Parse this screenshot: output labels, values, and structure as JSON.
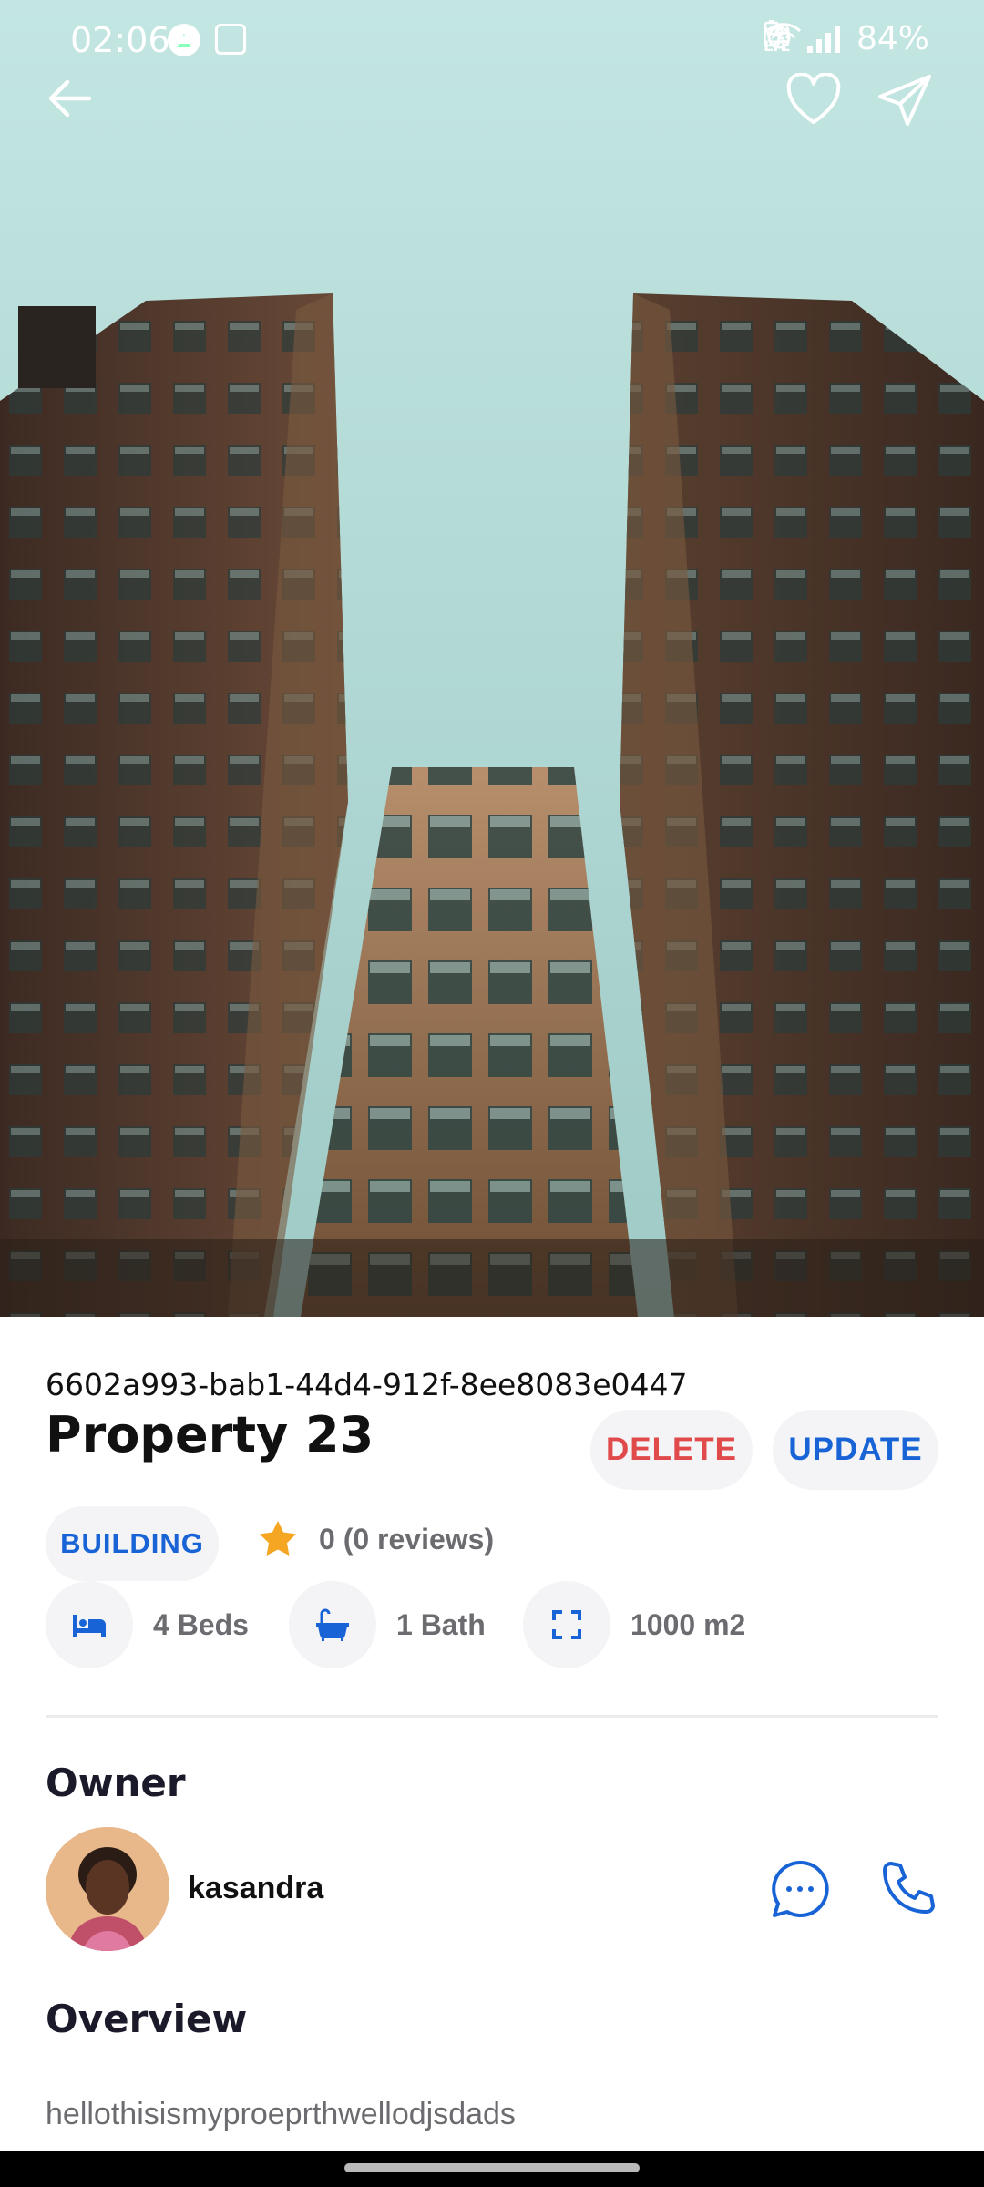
{
  "status_bar": {
    "time": "02:06",
    "battery": "84%",
    "left_icons": [
      "app-a-icon",
      "gallery-icon",
      "weather-icon"
    ],
    "right_icons": [
      "alarm-icon",
      "wifi-icon",
      "volte-icon",
      "signal-icon",
      "battery-icon"
    ]
  },
  "header": {
    "icons": [
      "back-arrow-icon",
      "heart-icon",
      "send-icon"
    ]
  },
  "property": {
    "id": "6602a993-bab1-44d4-912f-8ee8083e0447",
    "title": "Property 23",
    "delete_label": "DELETE",
    "update_label": "UPDATE",
    "type": "BUILDING",
    "rating_text": "0 (0 reviews)",
    "features": [
      {
        "icon": "bed-icon",
        "label": "4 Beds"
      },
      {
        "icon": "bath-icon",
        "label": "1 Bath"
      },
      {
        "icon": "area-expand-icon",
        "label": "1000 m2"
      }
    ]
  },
  "owner": {
    "section_title": "Owner",
    "name": "kasandra",
    "actions": [
      "message-icon",
      "phone-icon"
    ]
  },
  "overview": {
    "section_title": "Overview",
    "text": "hellothisismyproeprthwellodjsdads"
  },
  "colors": {
    "accent": "#1864d6",
    "danger": "#e04a4a",
    "star": "#f5a623",
    "muted_text": "#6b6b70"
  }
}
